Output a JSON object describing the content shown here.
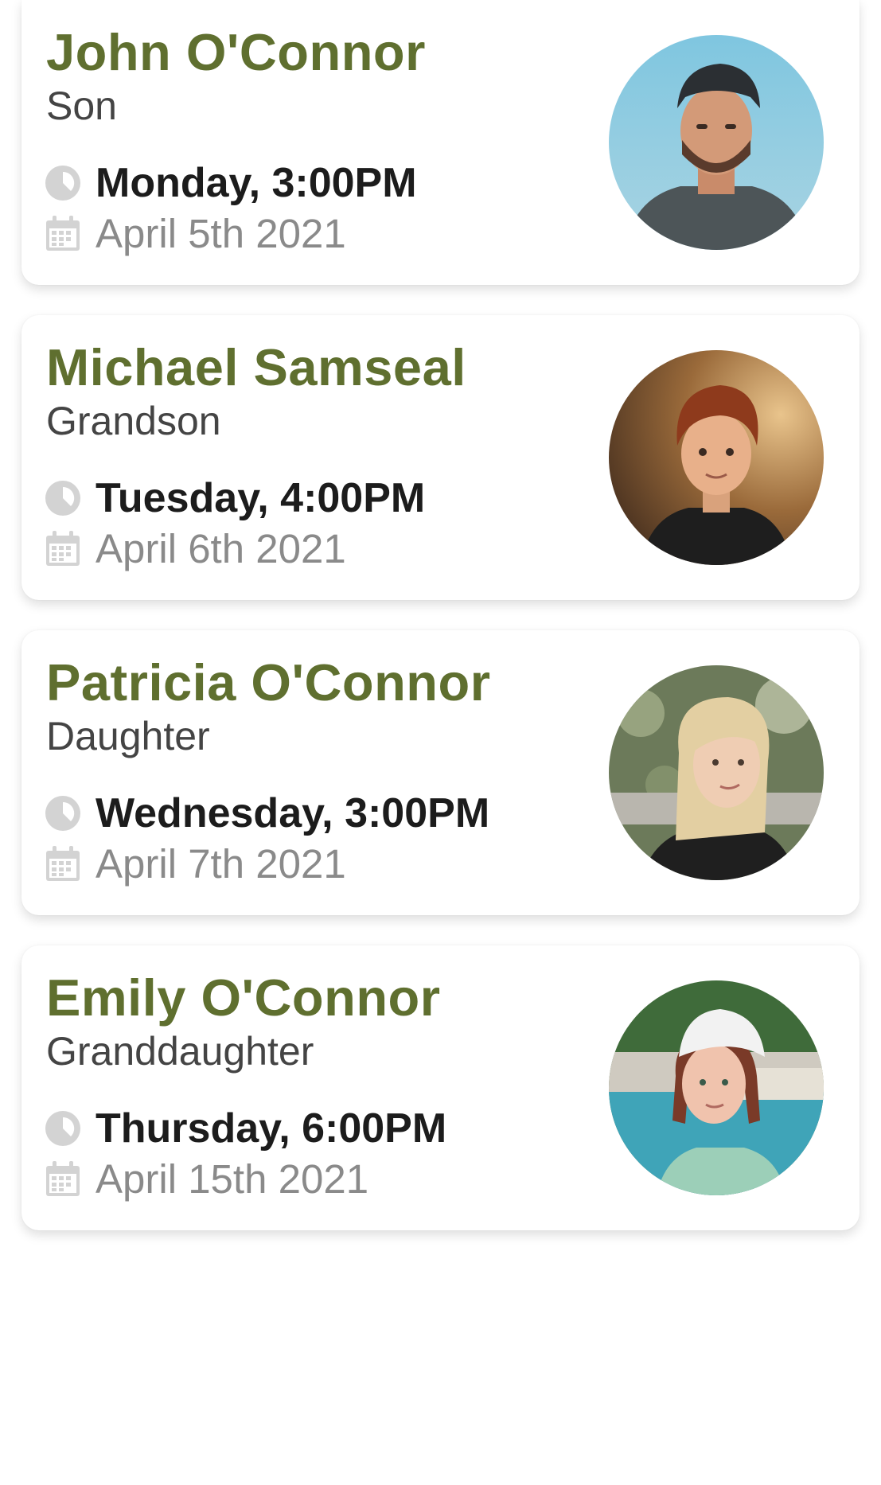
{
  "theme": {
    "name_color": "#5f6f2f",
    "icon_color": "#d3d3d3"
  },
  "contacts": [
    {
      "name": "John O'Connor",
      "relation": "Son",
      "time": "Monday, 3:00PM",
      "date": "April 5th 2021",
      "photo": "young-man-cap-photo"
    },
    {
      "name": "Michael Samseal",
      "relation": "Grandson",
      "time": "Tuesday, 4:00PM",
      "date": "April 6th 2021",
      "photo": "boy-red-hair-photo"
    },
    {
      "name": "Patricia O'Connor",
      "relation": "Daughter",
      "time": "Wednesday, 3:00PM",
      "date": "April 7th 2021",
      "photo": "blonde-woman-photo"
    },
    {
      "name": "Emily O'Connor",
      "relation": "Granddaughter",
      "time": "Thursday, 6:00PM",
      "date": "April 15th 2021",
      "photo": "girl-bandana-pool-photo"
    }
  ],
  "icons": {
    "time": "clock-icon",
    "date": "calendar-icon"
  }
}
